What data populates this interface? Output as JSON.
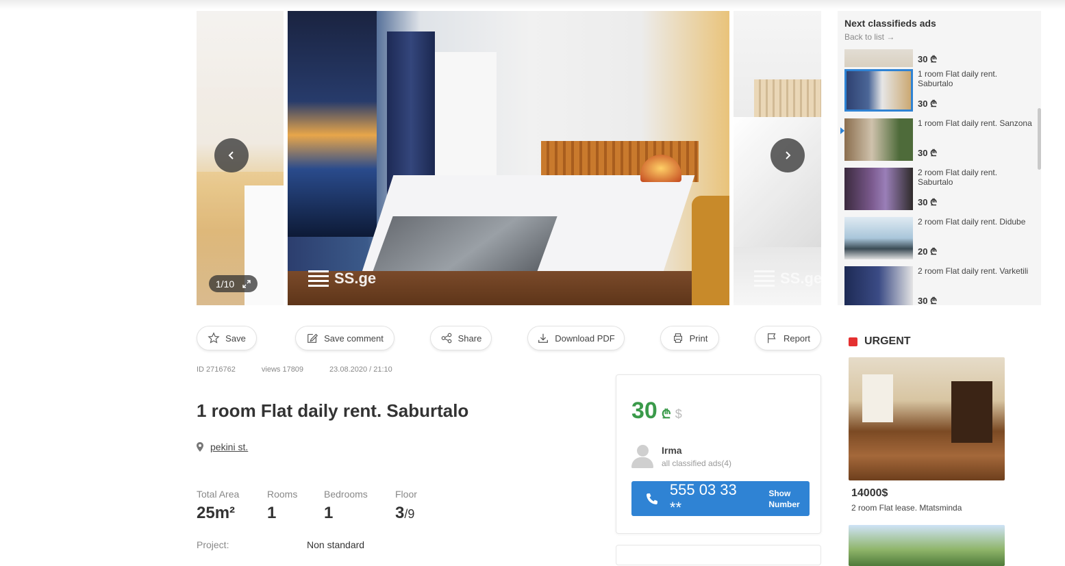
{
  "gallery": {
    "counter": "1/10",
    "watermark": "SS.ge",
    "prev_icon": "chevron-left-icon",
    "next_icon": "chevron-right-icon"
  },
  "actions": {
    "save": "Save",
    "save_comment": "Save comment",
    "share": "Share",
    "download_pdf": "Download PDF",
    "print": "Print",
    "report": "Report"
  },
  "meta": {
    "id": "ID 2716762",
    "views": "views 17809",
    "date": "23.08.2020 / 21:10"
  },
  "listing": {
    "title": "1 room Flat daily rent. Saburtalo",
    "address": "pekini st.",
    "specs": [
      {
        "label": "Total Area",
        "value": "25m²"
      },
      {
        "label": "Rooms",
        "value": "1"
      },
      {
        "label": "Bedrooms",
        "value": "1"
      },
      {
        "label": "Floor",
        "value": "3",
        "value_sub": "/9"
      }
    ],
    "project_label": "Project:",
    "project_value": "Non standard"
  },
  "pricebox": {
    "price": "30",
    "currency_gel": "₾",
    "currency_usd": "$",
    "seller_name": "Irma",
    "seller_ads": "all classified ads(4)",
    "phone": "555 03 33 **",
    "show_number": "Show Number"
  },
  "next_ads": {
    "title": "Next classifieds ads",
    "back": "Back to list →",
    "items": [
      {
        "title": "",
        "price": "30 ₾"
      },
      {
        "title": "1 room Flat daily rent. Saburtalo",
        "price": "30 ₾"
      },
      {
        "title": "1 room Flat daily rent. Sanzona",
        "price": "30 ₾"
      },
      {
        "title": "2 room Flat daily rent. Saburtalo",
        "price": "30 ₾"
      },
      {
        "title": "2 room Flat daily rent. Didube",
        "price": "20 ₾"
      },
      {
        "title": "2 room Flat daily rent. Varketili",
        "price": "30 ₾"
      }
    ]
  },
  "urgent": {
    "label": "URGENT",
    "price": "14000$",
    "title": "2 room Flat lease. Mtatsminda"
  }
}
